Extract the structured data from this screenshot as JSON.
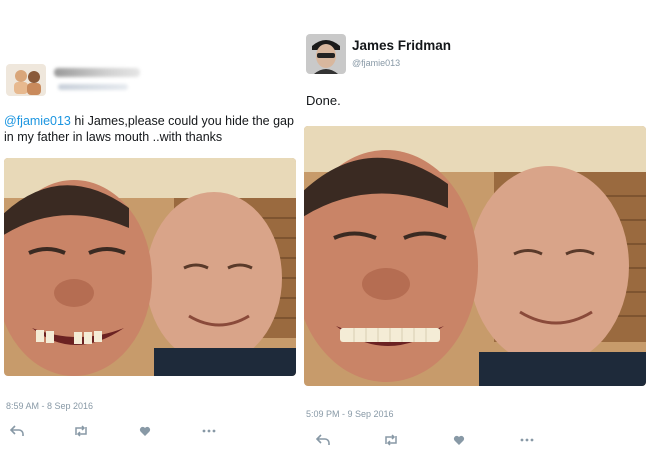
{
  "left_tweet": {
    "text_mention": "@fjamie013",
    "text_body": " hi James,please could you hide the gap in my father in laws mouth ..with thanks",
    "timestamp": "8:59 AM - 8 Sep 2016",
    "photo": {
      "description_icon": "selfie-photo",
      "state": "gap-in-teeth"
    },
    "actions": [
      "reply-icon",
      "retweet-icon",
      "like-icon",
      "more-icon"
    ]
  },
  "right_tweet": {
    "name": "James Fridman",
    "handle": "@fjamie013",
    "text": "Done.",
    "timestamp": "5:09 PM - 9 Sep 2016",
    "photo": {
      "description_icon": "selfie-photo",
      "state": "teeth-filled"
    },
    "actions": [
      "reply-icon",
      "retweet-icon",
      "like-icon",
      "more-icon"
    ]
  },
  "colors": {
    "link": "#1b95e0",
    "meta": "#8899a6",
    "text": "#14171a"
  }
}
